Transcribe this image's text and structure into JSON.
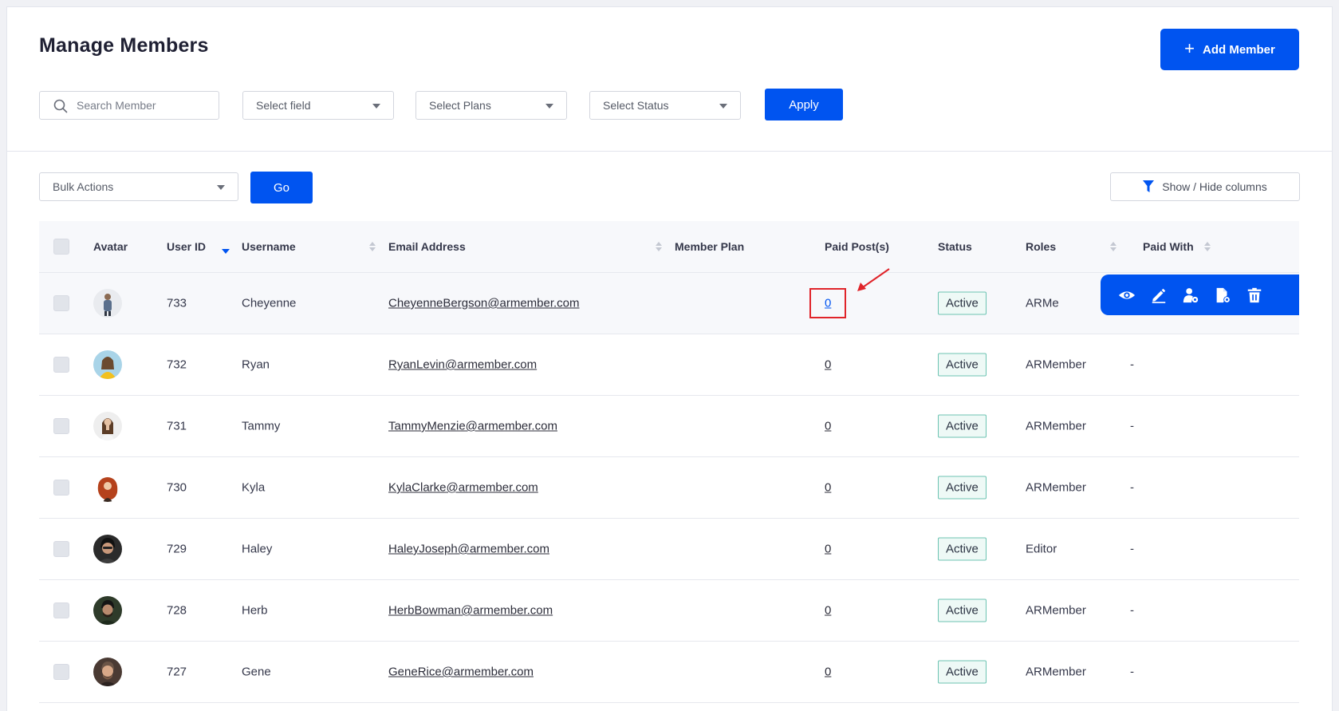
{
  "header": {
    "title": "Manage Members",
    "add_member_label": "Add Member"
  },
  "filters": {
    "search_placeholder": "Search Member",
    "select_field": "Select field",
    "select_plans": "Select Plans",
    "select_status": "Select Status",
    "apply_label": "Apply"
  },
  "toolbar": {
    "bulk_actions": "Bulk Actions",
    "go_label": "Go",
    "show_hide_columns": "Show / Hide columns"
  },
  "table": {
    "columns": {
      "avatar": "Avatar",
      "user_id": "User ID",
      "username": "Username",
      "email": "Email Address",
      "member_plan": "Member Plan",
      "paid_posts": "Paid Post(s)",
      "status": "Status",
      "roles": "Roles",
      "paid_with": "Paid With"
    },
    "rows": [
      {
        "user_id": "733",
        "username": "Cheyenne",
        "email": "CheyenneBergson@armember.com",
        "paid_posts": "0",
        "status": "Active",
        "role": "ARMe",
        "paid_with": ""
      },
      {
        "user_id": "732",
        "username": "Ryan",
        "email": "RyanLevin@armember.com",
        "paid_posts": "0",
        "status": "Active",
        "role": "ARMember",
        "paid_with": "-"
      },
      {
        "user_id": "731",
        "username": "Tammy",
        "email": "TammyMenzie@armember.com",
        "paid_posts": "0",
        "status": "Active",
        "role": "ARMember",
        "paid_with": "-"
      },
      {
        "user_id": "730",
        "username": "Kyla",
        "email": "KylaClarke@armember.com",
        "paid_posts": "0",
        "status": "Active",
        "role": "ARMember",
        "paid_with": "-"
      },
      {
        "user_id": "729",
        "username": "Haley",
        "email": "HaleyJoseph@armember.com",
        "paid_posts": "0",
        "status": "Active",
        "role": "Editor",
        "paid_with": "-"
      },
      {
        "user_id": "728",
        "username": "Herb",
        "email": "HerbBowman@armember.com",
        "paid_posts": "0",
        "status": "Active",
        "role": "ARMember",
        "paid_with": "-"
      },
      {
        "user_id": "727",
        "username": "Gene",
        "email": "GeneRice@armember.com",
        "paid_posts": "0",
        "status": "Active",
        "role": "ARMember",
        "paid_with": "-"
      }
    ]
  },
  "row_actions": [
    "view-icon",
    "edit-icon",
    "user-settings-icon",
    "document-settings-icon",
    "delete-icon"
  ],
  "colors": {
    "primary": "#0054f0",
    "status_border": "#6cc3b2",
    "highlight": "#e0242a"
  }
}
